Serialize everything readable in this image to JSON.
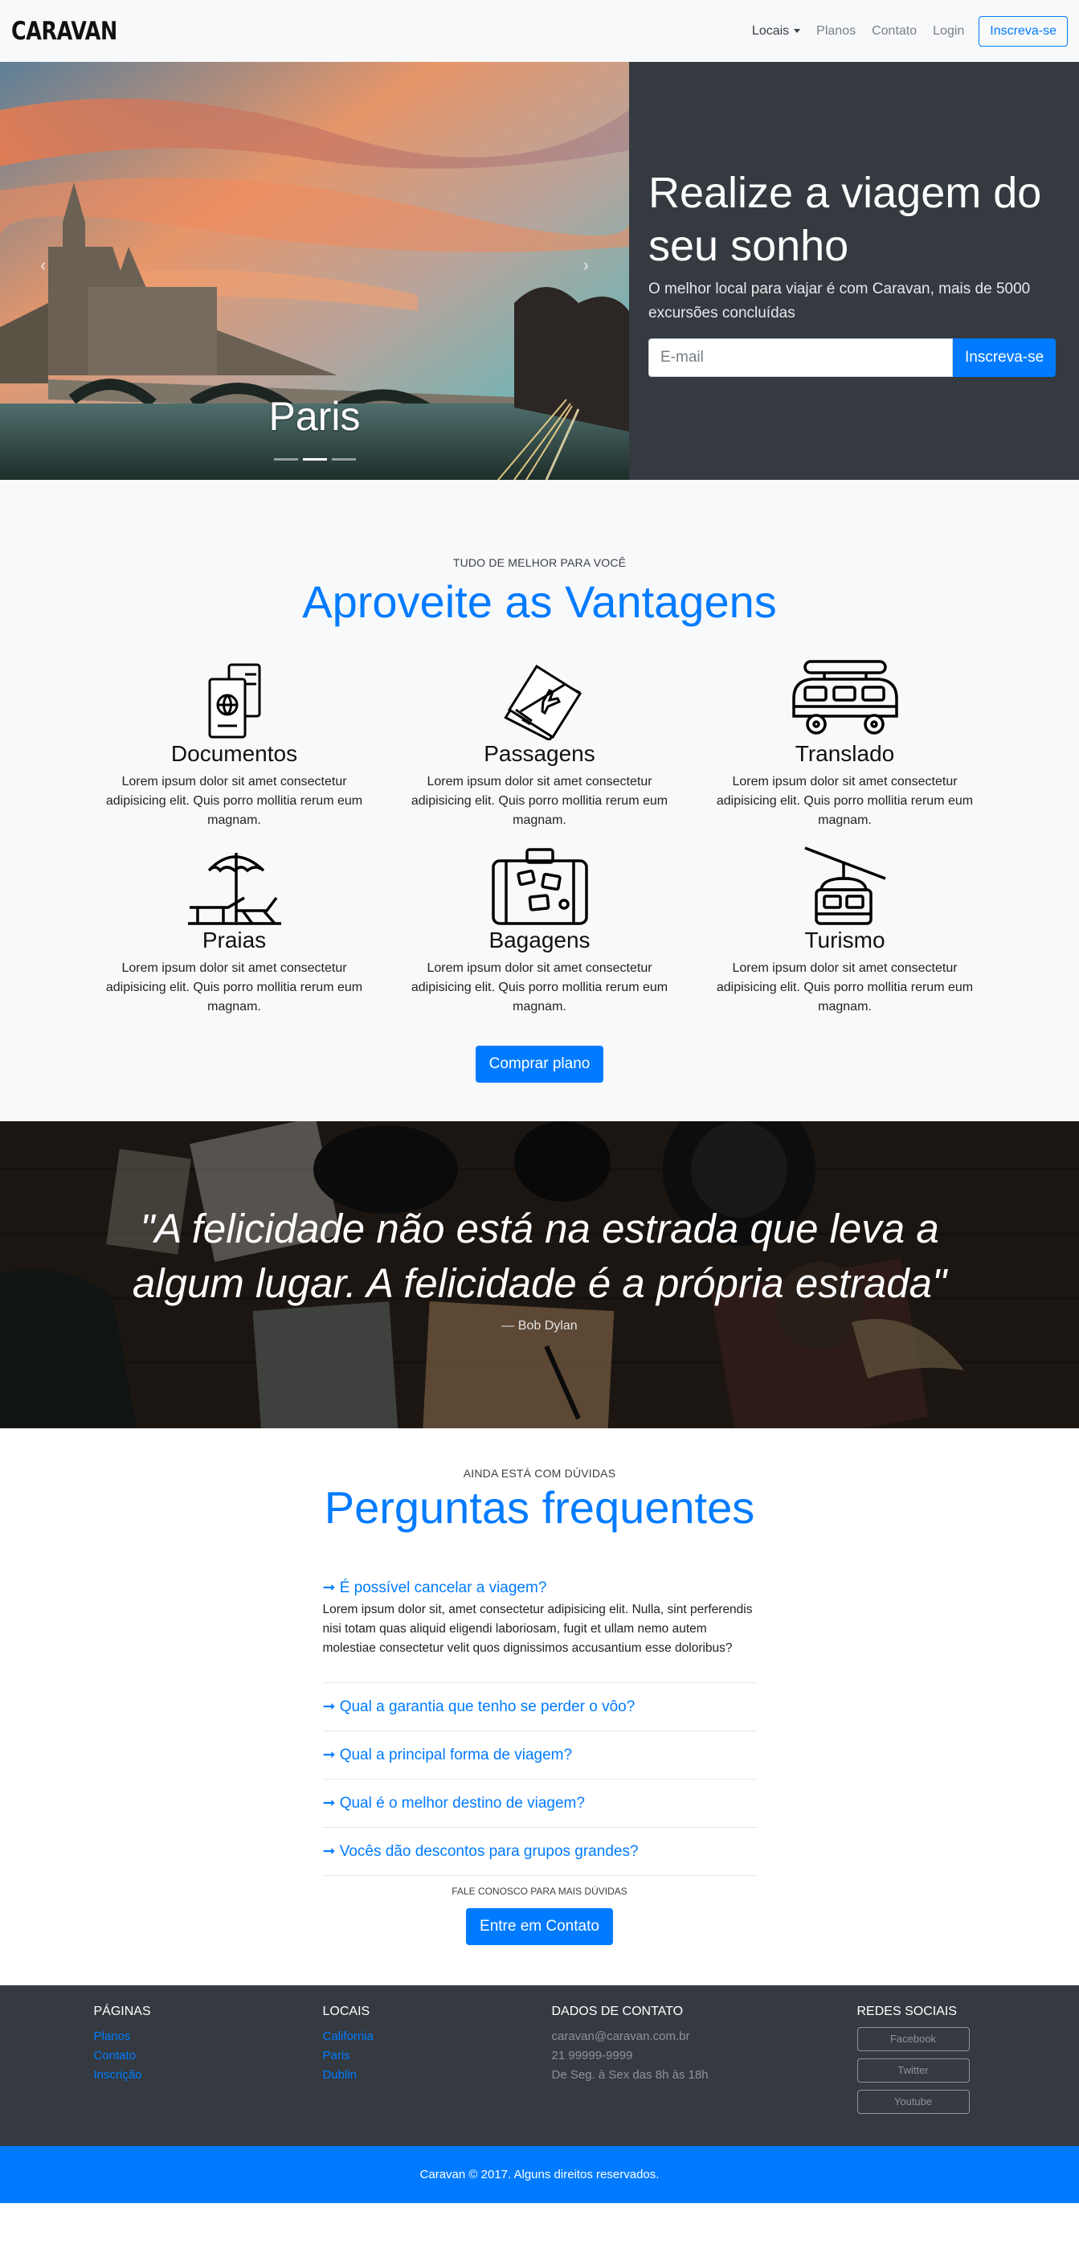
{
  "navbar": {
    "brand": "CARAVAN",
    "links": [
      {
        "label": "Locais"
      },
      {
        "label": "Planos"
      },
      {
        "label": "Contato"
      },
      {
        "label": "Login"
      }
    ],
    "cta": "Inscreva-se"
  },
  "hero": {
    "carousel_caption": "Paris",
    "title": "Realize a viagem do seu sonho",
    "subtitle": "O melhor local para viajar é com Caravan, mais de 5000 excursões concluídas",
    "email_placeholder": "E-mail",
    "signup_button": "Inscreva-se"
  },
  "features": {
    "eyebrow": "TUDO DE MELHOR PARA VOCÊ",
    "title": "Aproveite as Vantagens",
    "items": [
      {
        "title": "Documentos",
        "text": "Lorem ipsum dolor sit amet consectetur adipisicing elit. Quis porro mollitia rerum eum magnam.",
        "icon": "passport-icon"
      },
      {
        "title": "Passagens",
        "text": "Lorem ipsum dolor sit amet consectetur adipisicing elit. Quis porro mollitia rerum eum magnam.",
        "icon": "tickets-icon"
      },
      {
        "title": "Translado",
        "text": "Lorem ipsum dolor sit amet consectetur adipisicing elit. Quis porro mollitia rerum eum magnam.",
        "icon": "van-icon"
      },
      {
        "title": "Praias",
        "text": "Lorem ipsum dolor sit amet consectetur adipisicing elit. Quis porro mollitia rerum eum magnam.",
        "icon": "beach-umbrella-icon"
      },
      {
        "title": "Bagagens",
        "text": "Lorem ipsum dolor sit amet consectetur adipisicing elit. Quis porro mollitia rerum eum magnam.",
        "icon": "suitcase-icon"
      },
      {
        "title": "Turismo",
        "text": "Lorem ipsum dolor sit amet consectetur adipisicing elit. Quis porro mollitia rerum eum magnam.",
        "icon": "cable-car-icon"
      }
    ],
    "button": "Comprar plano"
  },
  "quote": {
    "text": "\"A felicidade não está na estrada que leva a algum lugar. A felicidade é a própria estrada\"",
    "author": "— Bob Dylan"
  },
  "faq": {
    "eyebrow": "AINDA ESTÁ COM DÚVIDAS",
    "title": "Perguntas frequentes",
    "items": [
      {
        "question": "➞ É possível cancelar a viagem?",
        "answer": "Lorem ipsum dolor sit, amet consectetur adipisicing elit. Nulla, sint perferendis nisi totam quas aliquid eligendi laboriosam, fugit et ullam nemo autem molestiae consectetur velit quos dignissimos accusantium esse doloribus?"
      },
      {
        "question": "➞ Qual a garantia que tenho se perder o vôo?"
      },
      {
        "question": "➞ Qual a principal forma de viagem?"
      },
      {
        "question": "➞ Qual é o melhor destino de viagem?"
      },
      {
        "question": "➞ Vocês dão descontos para grupos grandes?"
      }
    ],
    "footnote": "FALE CONOSCO PARA MAIS DÚVIDAS",
    "button": "Entre em Contato"
  },
  "footer": {
    "pages": {
      "heading": "PÁGINAS",
      "links": [
        "Planos",
        "Contato",
        "Inscrição"
      ]
    },
    "places": {
      "heading": "LOCAIS",
      "links": [
        "California",
        "Paris",
        "Dublin"
      ]
    },
    "contact": {
      "heading": "DADOS DE CONTATO",
      "lines": [
        "caravan@caravan.com.br",
        "21 99999-9999",
        "De Seg. à Sex das 8h às 18h"
      ]
    },
    "social": {
      "heading": "REDES SOCIAIS",
      "buttons": [
        "Facebook",
        "Twitter",
        "Youtube"
      ]
    },
    "copyright": "Caravan © 2017. Alguns direitos reservados."
  },
  "colors": {
    "accent": "#007bff",
    "dark": "#343a40",
    "light": "#f8f9fa"
  }
}
